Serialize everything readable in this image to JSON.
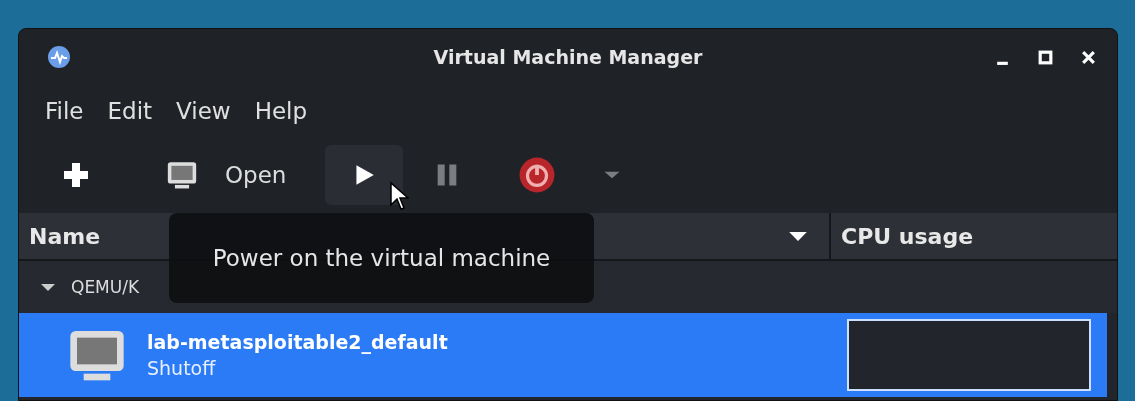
{
  "window": {
    "title": "Virtual Machine Manager"
  },
  "menu": [
    {
      "label": "File"
    },
    {
      "label": "Edit"
    },
    {
      "label": "View"
    },
    {
      "label": "Help"
    }
  ],
  "toolbar": [
    {
      "kind": "new",
      "disabled": false,
      "hovered": false
    },
    {
      "kind": "open",
      "label": "Open",
      "disabled": false,
      "hovered": false
    },
    {
      "kind": "run",
      "disabled": false,
      "hovered": true
    },
    {
      "kind": "pause",
      "disabled": true,
      "hovered": false
    },
    {
      "kind": "shutdown",
      "disabled": false,
      "hovered": false
    },
    {
      "kind": "menu",
      "disabled": true,
      "hovered": false
    }
  ],
  "tooltip": {
    "text": "Power on the virtual machine"
  },
  "table": {
    "columns": [
      {
        "label": "Name"
      },
      {
        "label": "CPU usage"
      }
    ],
    "groups": [
      {
        "label": "QEMU/K",
        "expanded": true,
        "rows": [
          {
            "name": "lab-metasploitable2_default",
            "status": "Shutoff",
            "selected": true
          }
        ]
      }
    ]
  }
}
